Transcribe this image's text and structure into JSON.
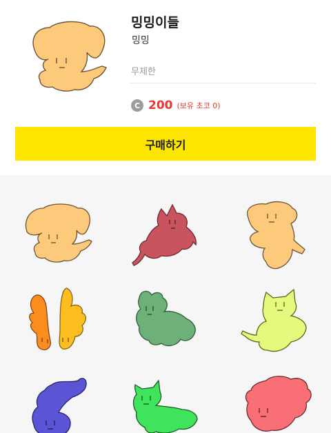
{
  "product": {
    "title": "밍밍이들",
    "author": "밍밍",
    "period": "무제한",
    "price_icon": "C",
    "price": "200",
    "owned": "(보유 초코 0)",
    "buy_label": "구매하기"
  },
  "colors": {
    "accent_yellow": "#fee500",
    "price_red": "#e5392c"
  },
  "stickers": [
    {
      "name": "sticker-puppy-orange",
      "color": "#fdc97b"
    },
    {
      "name": "sticker-cat-red",
      "color": "#c9535e"
    },
    {
      "name": "sticker-puppy-reaching",
      "color": "#fdc97b"
    },
    {
      "name": "sticker-butterflies",
      "color": "#fb8c1e"
    },
    {
      "name": "sticker-bunny-green",
      "color": "#6db07a"
    },
    {
      "name": "sticker-cat-lime",
      "color": "#e7f97c"
    },
    {
      "name": "sticker-blue-creature",
      "color": "#5b55d6"
    },
    {
      "name": "sticker-cat-green",
      "color": "#3fe35c"
    },
    {
      "name": "sticker-bear-pink",
      "color": "#f96f76"
    }
  ]
}
